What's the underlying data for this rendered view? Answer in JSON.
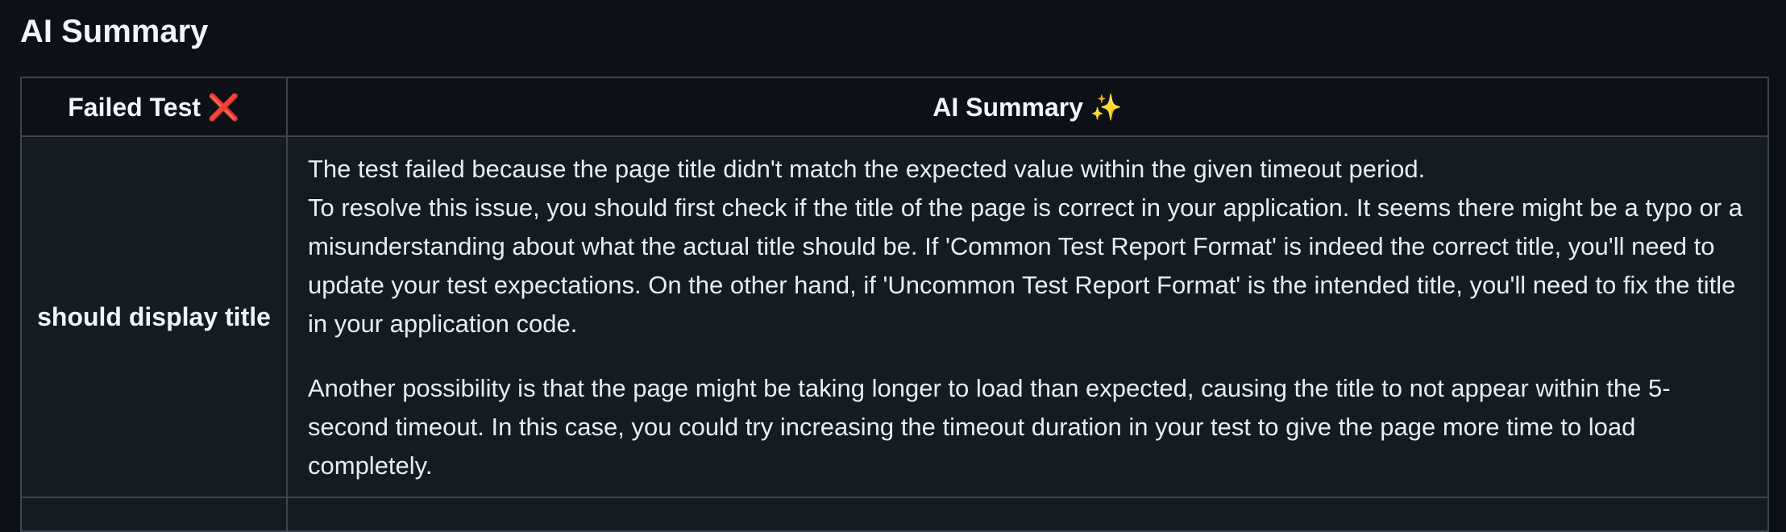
{
  "page": {
    "title": "AI Summary"
  },
  "table": {
    "headers": {
      "failed_test": "Failed Test",
      "failed_icon": "❌",
      "ai_summary": "AI Summary",
      "ai_icon": "✨"
    },
    "rows": [
      {
        "test_name": "should display title",
        "summary": {
          "line1": "The test failed because the page title didn't match the expected value within the given timeout period.",
          "para1": "To resolve this issue, you should first check if the title of the page is correct in your application. It seems there might be a typo or a misunderstanding about what the actual title should be. If 'Common Test Report Format' is indeed the correct title, you'll need to update your test expectations. On the other hand, if 'Uncommon Test Report Format' is the intended title, you'll need to fix the title in your application code.",
          "para2": "Another possibility is that the page might be taking longer to load than expected, causing the title to not appear within the 5-second timeout. In this case, you could try increasing the timeout duration in your test to give the page more time to load completely."
        }
      }
    ]
  }
}
